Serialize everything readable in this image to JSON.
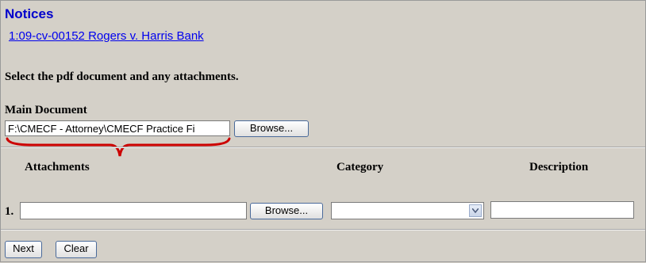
{
  "page": {
    "title": "Notices",
    "case_link": "1:09-cv-00152 Rogers v. Harris Bank",
    "instruction": "Select the pdf document and any attachments."
  },
  "main_document": {
    "label": "Main Document",
    "file_value": "F:\\CMECF - Attorney\\CMECF Practice Fi",
    "browse_label": "Browse..."
  },
  "attachments": {
    "headers": {
      "attachments": "Attachments",
      "category": "Category",
      "description": "Description"
    },
    "rows": [
      {
        "number": "1.",
        "file_value": "",
        "browse_label": "Browse...",
        "category": "",
        "description": ""
      }
    ]
  },
  "actions": {
    "next_label": "Next",
    "clear_label": "Clear"
  },
  "colors": {
    "title": "#0000cc",
    "link": "#0000ee",
    "bracket": "#cc0000",
    "background": "#d4d0c8"
  }
}
